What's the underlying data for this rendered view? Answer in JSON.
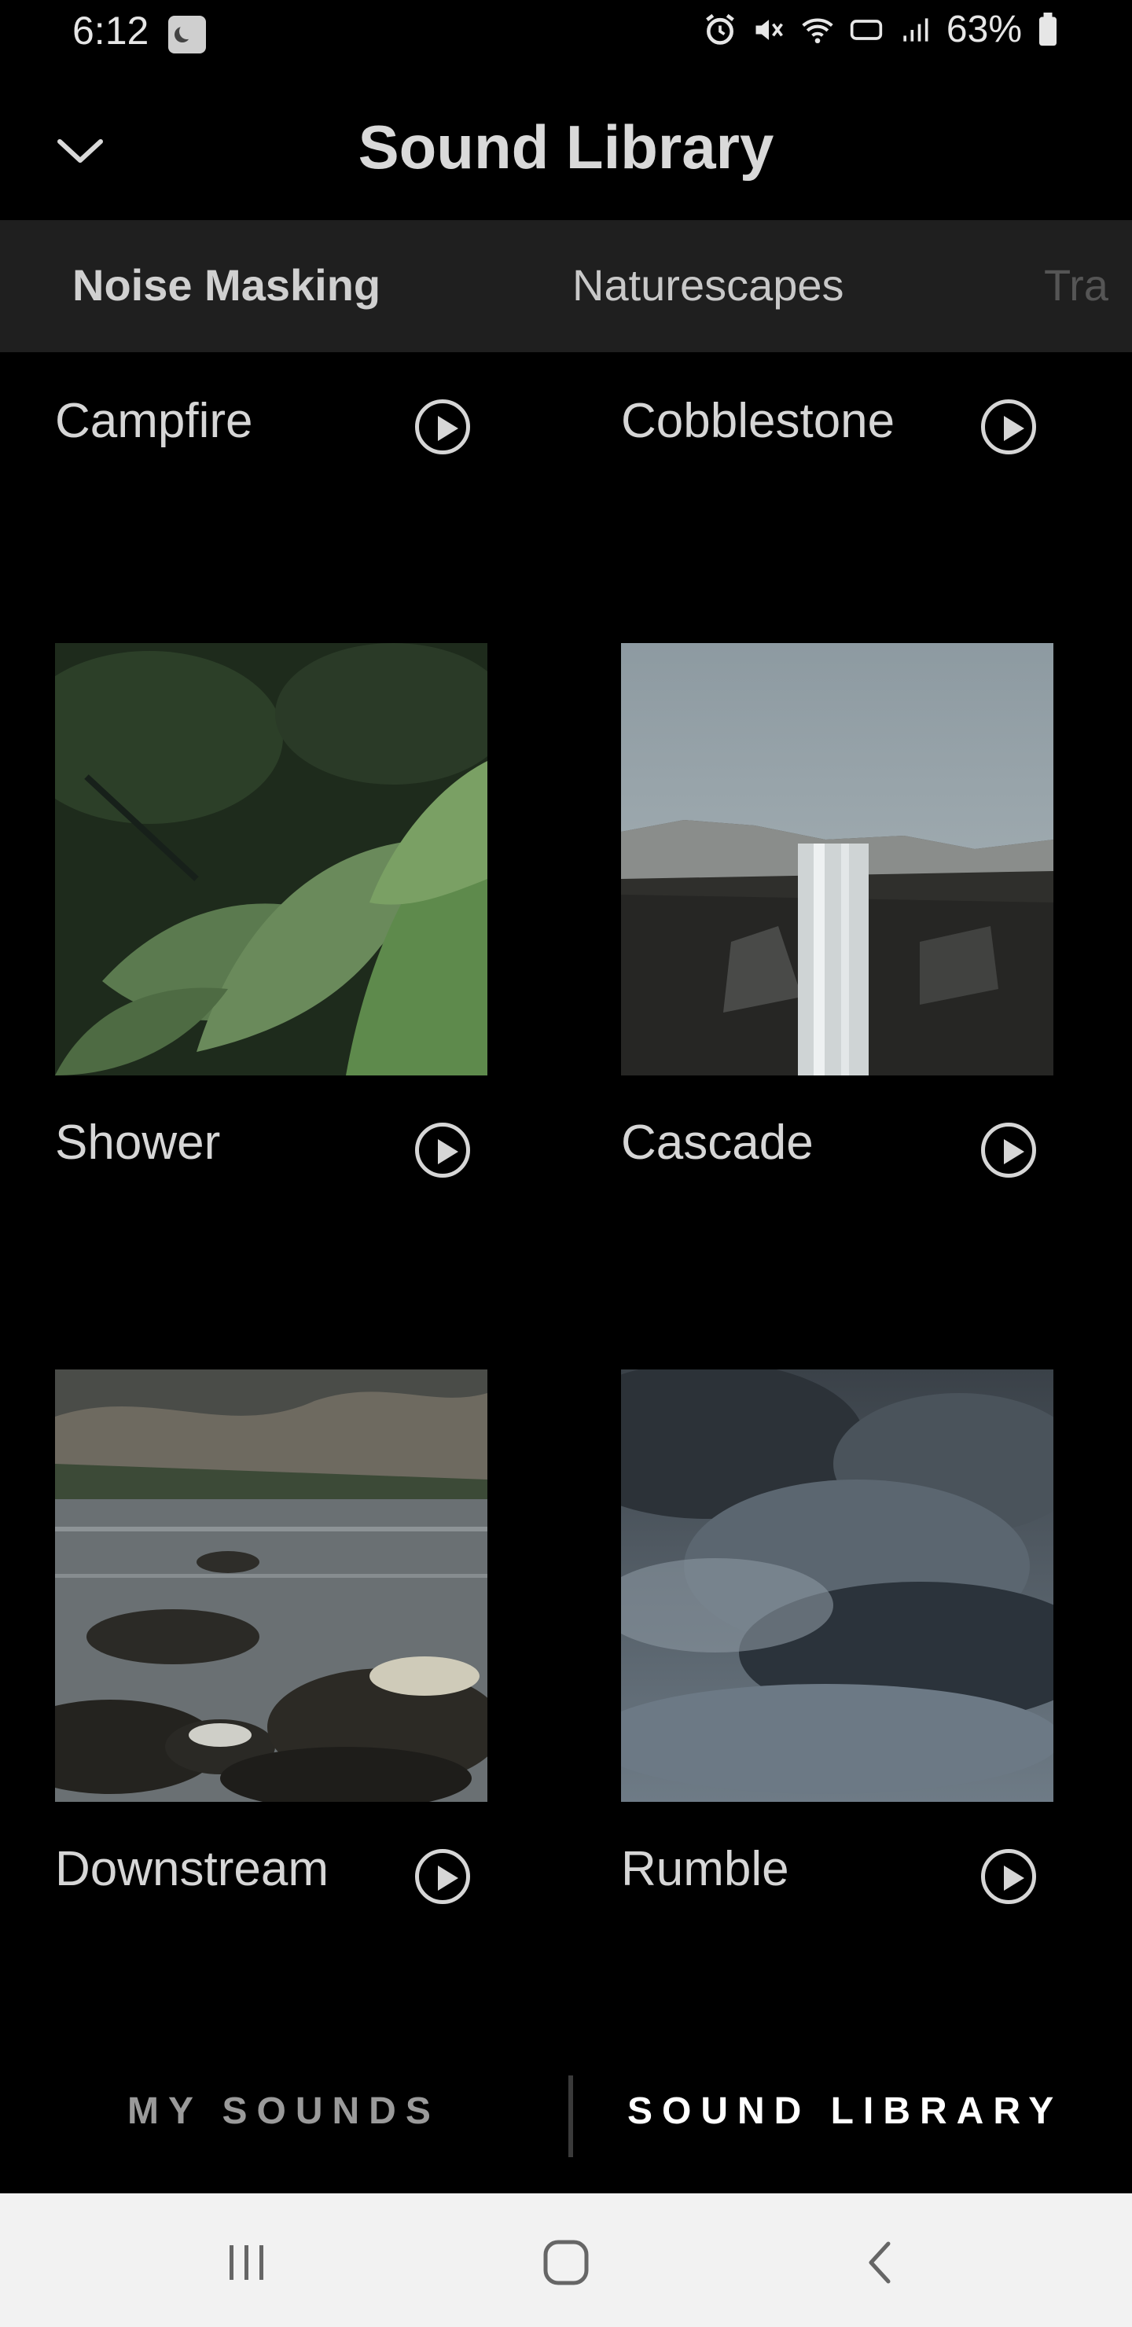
{
  "status_bar": {
    "time": "6:12",
    "battery": "63%"
  },
  "header": {
    "title": "Sound Library"
  },
  "tabs": [
    {
      "label": "Noise Masking",
      "active": true
    },
    {
      "label": "Naturescapes",
      "active": false
    },
    {
      "label": "Tra",
      "active": false
    }
  ],
  "sounds": [
    {
      "name": "Campfire"
    },
    {
      "name": "Cobblestone"
    },
    {
      "name": "Shower"
    },
    {
      "name": "Cascade"
    },
    {
      "name": "Downstream"
    },
    {
      "name": "Rumble"
    }
  ],
  "bottom_nav": {
    "my_sounds": "MY SOUNDS",
    "sound_library": "SOUND LIBRARY",
    "active": "sound_library"
  },
  "colors": {
    "background": "#000000",
    "tab_bar": "#1f1f1f",
    "text": "#d9d9d9",
    "system_nav": "#f2f2f2"
  }
}
